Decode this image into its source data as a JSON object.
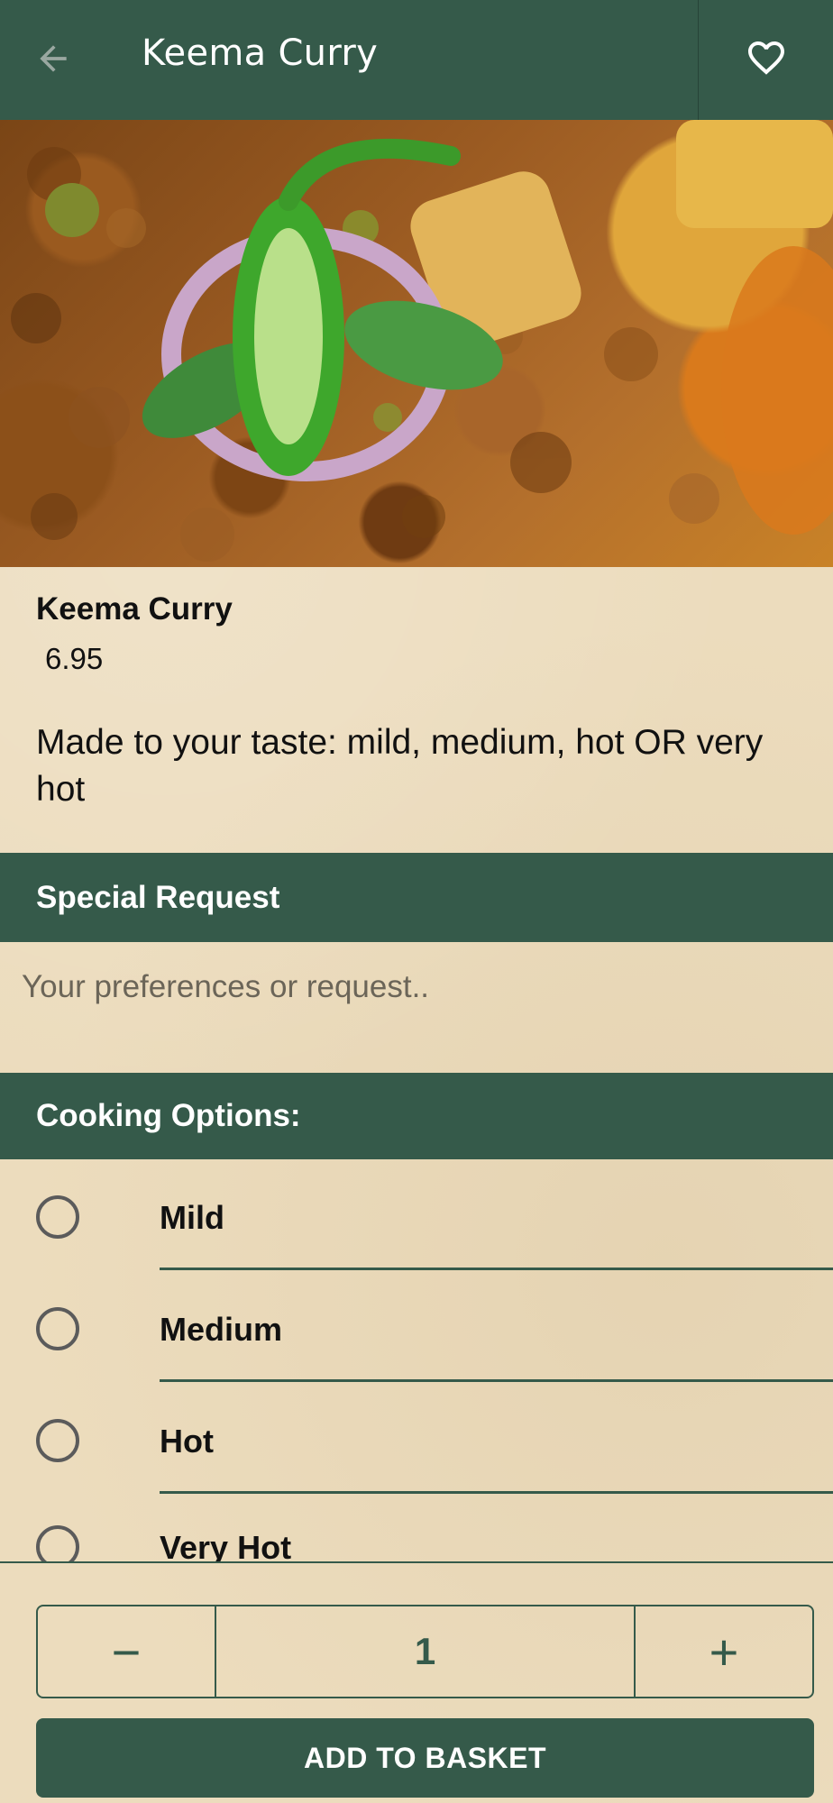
{
  "header": {
    "title": "Keema Curry",
    "back_icon": "arrow-left-icon",
    "favorite_icon": "heart-outline-icon"
  },
  "hero": {
    "image": "keema-curry-photo"
  },
  "item": {
    "name": "Keema Curry",
    "price": "6.95",
    "description": "Made to your taste: mild, medium, hot OR very hot"
  },
  "special_request": {
    "heading": "Special Request",
    "placeholder": "Your preferences or request.."
  },
  "cooking_options": {
    "heading": "Cooking Options:",
    "options": [
      {
        "label": "Mild"
      },
      {
        "label": "Medium"
      },
      {
        "label": "Hot"
      },
      {
        "label": "Very Hot"
      }
    ]
  },
  "quantity": {
    "minus": "−",
    "value": "1",
    "plus": "+"
  },
  "actions": {
    "add_to_basket": "ADD TO BASKET"
  },
  "colors": {
    "primary": "#355a4a",
    "background": "#ecdcbd"
  }
}
